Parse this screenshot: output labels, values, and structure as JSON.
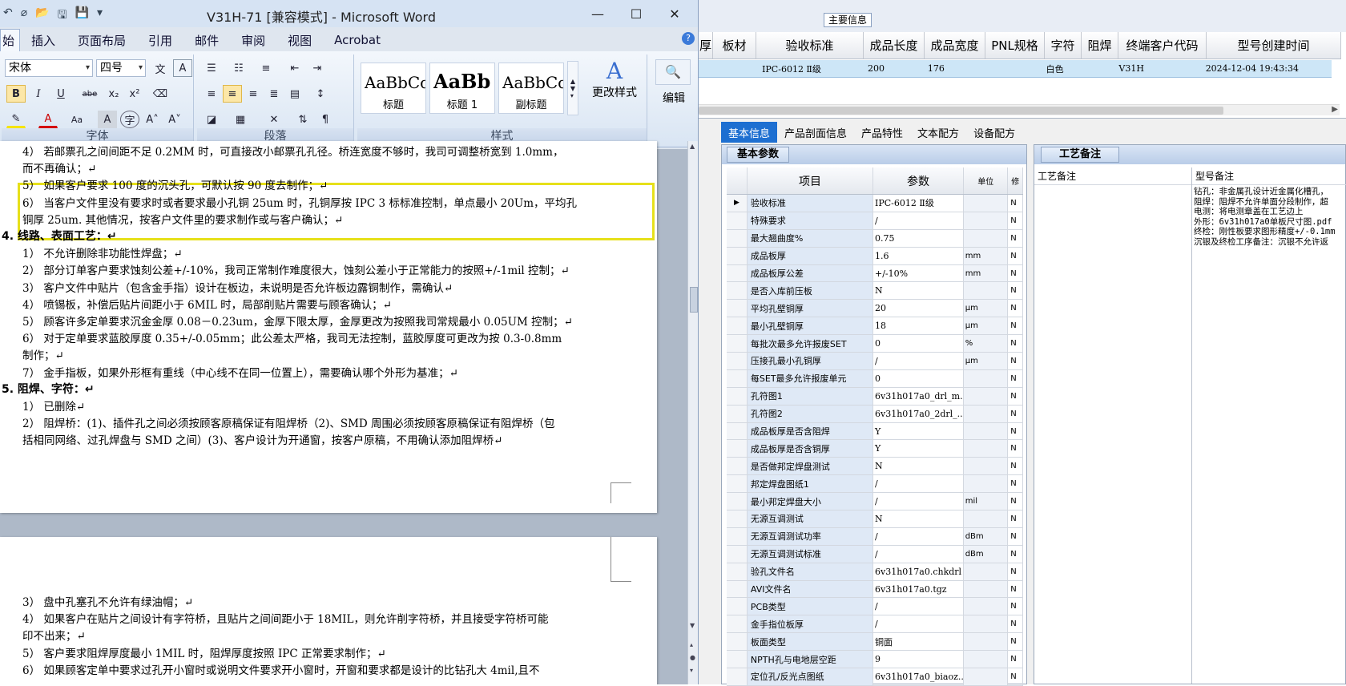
{
  "word": {
    "title": "V31H-71 [兼容模式] - Microsoft Word",
    "quick_access": [
      "↶",
      "⌀",
      "📂",
      "🖫",
      "💾",
      "▾"
    ],
    "window_controls": [
      "—",
      "☐",
      "✕"
    ],
    "tabs": [
      "始",
      "插入",
      "页面布局",
      "引用",
      "邮件",
      "审阅",
      "视图",
      "Acrobat"
    ],
    "help": "?",
    "ribbon": {
      "font_name": "宋体",
      "font_size": "四号",
      "font_group_label": "字体",
      "paragraph_group_label": "段落",
      "styles_group_label": "样式",
      "styles": [
        {
          "sample": "AaBbCcI",
          "name": "标题"
        },
        {
          "sample": "AaBb",
          "name": "标题 1"
        },
        {
          "sample": "AaBbCcI",
          "name": "副标题"
        }
      ],
      "change_styles_label": "更改样式",
      "edit_label": "编辑",
      "format_buttons": [
        "B",
        "I",
        "U",
        "abe",
        "x₂",
        "x²",
        "A",
        "A",
        "Aa",
        "A",
        "字",
        "A˄",
        "A˅"
      ]
    },
    "page1_lines": [
      "4）  若邮票孔之间间距不足 0.2MM 时，可直接改小邮票孔孔径。桥连宽度不够时，我司可调整桥宽到 1.0mm，",
      "      而不再确认；↵",
      "5）  如果客户要求 100 度的沉头孔，可默认按 90 度去制作；↵",
      "6）  当客户文件里没有要求时或者要求最小孔铜 25um 时，孔铜厚按 IPC 3 标标准控制，单点最小 20Um，平均孔",
      "      铜厚 25um. 其他情况，按客户文件里的要求制作或与客户确认；↵",
      "4.  线路、表面工艺：↵",
      "1）  不允许删除非功能性焊盘；↵",
      "2）  部分订单客户要求蚀刻公差+/-10%，我司正常制作难度很大，蚀刻公差小于正常能力的按照+/-1mil 控制；↵",
      "3）  客户文件中贴片（包含金手指）设计在板边，未说明是否允许板边露铜制作，需确认↵",
      "4）  喷锡板，补偿后贴片间距小于 6MIL 时，局部削贴片需要与顾客确认；↵",
      "5）  顾客许多定单要求沉金金厚 0.08－0.23um，金厚下限太厚，金厚更改为按照我司常规最小 0.05UM 控制；↵",
      "6）  对于定单要求蓝胶厚度 0.35+/-0.05mm；此公差太严格，我司无法控制，蓝胶厚度可更改为按 0.3-0.8mm",
      "      制作；↵",
      "7）  金手指板，如果外形框有重线（中心线不在同一位置上），需要确认哪个外形为基准；↵",
      "5.  阻焊、字符：↵",
      "1）  已删除↵",
      "2）  阻焊桥：(1)、插件孔之间必须按顾客原稿保证有阻焊桥（2)、SMD 周围必须按顾客原稿保证有阻焊桥（包",
      "      括相同网络、过孔焊盘与 SMD 之间）(3)、客户设计为开通窗，按客户原稿，不用确认添加阻焊桥↵"
    ],
    "page2_lines": [
      "3）  盘中孔塞孔不允许有绿油帽；↵",
      "4）  如果客户在贴片之间设计有字符桥，且贴片之间间距小于 18MIL，则允许削字符桥，并且接受字符桥可能",
      "      印不出来；↵",
      "5）  客户要求阻焊厚度最小 1MIL 时，阻焊厚度按照 IPC 正常要求制作；↵",
      "6）  如果顾客定单中要求过孔开小窗时或说明文件要求开小窗时，开窗和要求都是设计的比钻孔大 4mil,且不"
    ]
  },
  "app": {
    "main_info_tab": "主要信息",
    "grid_headers": [
      "厚",
      "板材",
      "验收标准",
      "成品长度",
      "成品宽度",
      "PNL规格",
      "字符",
      "阻焊",
      "终端客户代码",
      "型号创建时间"
    ],
    "grid_row": [
      "",
      "",
      "IPC-6012 Ⅱ级",
      "200",
      "176",
      "",
      "白色",
      "",
      "V31H",
      "2024-12-04 19:43:34"
    ],
    "tabs": [
      "基本信息",
      "产品剖面信息",
      "产品特性",
      "文本配方",
      "设备配方"
    ],
    "params_title": "基本参数",
    "params_headers": [
      "项目",
      "参数",
      "单位",
      "修"
    ],
    "params_rows": [
      [
        "验收标准",
        "IPC-6012 Ⅱ级",
        "",
        "N"
      ],
      [
        "特殊要求",
        "/",
        "",
        "N"
      ],
      [
        "最大翘曲度%",
        "0.75",
        "",
        "N"
      ],
      [
        "成品板厚",
        "1.6",
        "mm",
        "N"
      ],
      [
        "成品板厚公差",
        "+/-10%",
        "mm",
        "N"
      ],
      [
        "是否入库前压板",
        "N",
        "",
        "N"
      ],
      [
        "平均孔壁铜厚",
        "20",
        "μm",
        "N"
      ],
      [
        "最小孔壁铜厚",
        "18",
        "μm",
        "N"
      ],
      [
        "每批次最多允许报废SET",
        "0",
        "%",
        "N"
      ],
      [
        "压接孔最小孔铜厚",
        "/",
        "μm",
        "N"
      ],
      [
        "每SET最多允许报废单元",
        "0",
        "",
        "N"
      ],
      [
        "孔符图1",
        "6v31h017a0_drl_m...",
        "",
        "N"
      ],
      [
        "孔符图2",
        "6v31h017a0_2drl_...",
        "",
        "N"
      ],
      [
        "成品板厚是否含阻焊",
        "Y",
        "",
        "N"
      ],
      [
        "成品板厚是否含铜厚",
        "Y",
        "",
        "N"
      ],
      [
        "是否做邦定焊盘测试",
        "N",
        "",
        "N"
      ],
      [
        "邦定焊盘图纸1",
        "/",
        "",
        "N"
      ],
      [
        "最小邦定焊盘大小",
        "/",
        "mil",
        "N"
      ],
      [
        "无源互调测试",
        "N",
        "",
        "N"
      ],
      [
        "无源互调测试功率",
        "/",
        "dBm",
        "N"
      ],
      [
        "无源互调测试标准",
        "/",
        "dBm",
        "N"
      ],
      [
        "验孔文件名",
        "6v31h017a0.chkdrl",
        "",
        "N"
      ],
      [
        "AVI文件名",
        "6v31h017a0.tgz",
        "",
        "N"
      ],
      [
        "PCB类型",
        "/",
        "",
        "N"
      ],
      [
        "金手指位板厚",
        "/",
        "",
        "N"
      ],
      [
        "板面类型",
        "铜面",
        "",
        "N"
      ],
      [
        "NPTH孔与电地层空距",
        "9",
        "",
        "N"
      ],
      [
        "定位孔/反光点图纸",
        "6v31h017a0_biaoz...",
        "",
        "N"
      ]
    ],
    "process_title": "工艺备注",
    "process_col1_header": "工艺备注",
    "process_col2_header": "型号备注",
    "model_notes": [
      "钻孔：非金属孔设计近金属化槽孔，",
      "阻焊：阻焊不允许单面分段制作，超",
      "电测：将电测章盖在工艺边上",
      "外形：6v31h017a0单板尺寸图.pdf",
      "终检：刚性板要求图形精度+/-0.1mm",
      "沉银及终检工序备注：沉银不允许返"
    ]
  }
}
